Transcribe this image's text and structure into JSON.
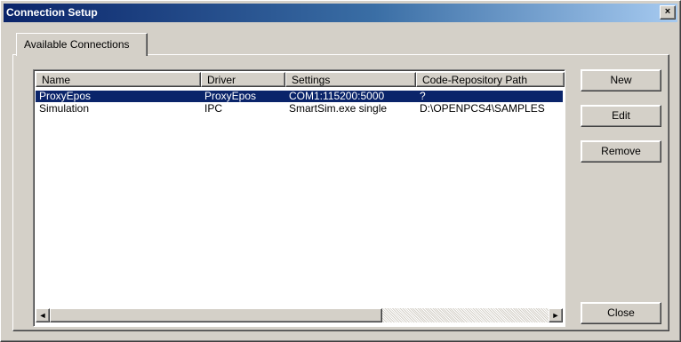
{
  "window": {
    "title": "Connection Setup",
    "close_glyph": "×"
  },
  "tabs": [
    {
      "label": "Available Connections"
    }
  ],
  "table": {
    "columns": [
      "Name",
      "Driver",
      "Settings",
      "Code-Repository Path"
    ],
    "rows": [
      {
        "name": "ProxyEpos",
        "driver": "ProxyEpos",
        "settings": "COM1:115200:5000",
        "path": "?",
        "selected": true
      },
      {
        "name": "Simulation",
        "driver": "IPC",
        "settings": "SmartSim.exe single",
        "path": "D:\\OPENPCS4\\SAMPLES",
        "selected": false
      }
    ]
  },
  "buttons": {
    "new": "New",
    "edit": "Edit",
    "remove": "Remove",
    "close": "Close"
  },
  "scrollbar": {
    "left_glyph": "◄",
    "right_glyph": "►"
  },
  "colors": {
    "title_start": "#0a246a",
    "title_end": "#a6caf0",
    "selection": "#0a246a",
    "face": "#d4d0c8"
  }
}
